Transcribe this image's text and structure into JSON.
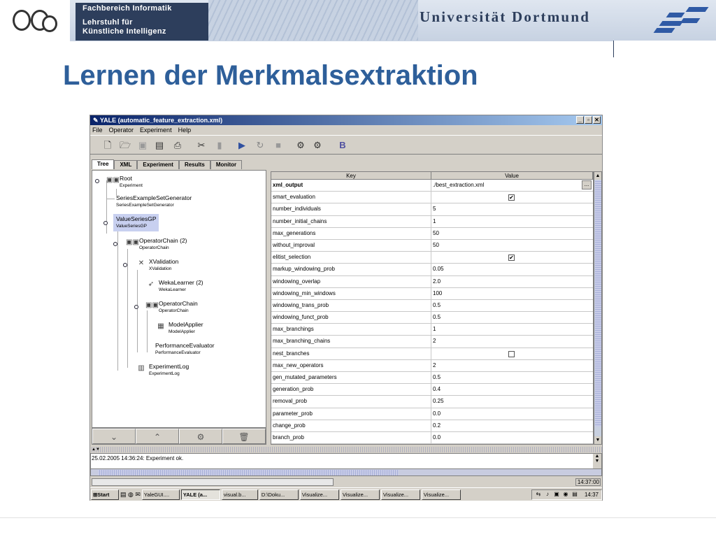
{
  "banner": {
    "dept_line1": "Fachbereich Informatik",
    "dept_line2": "Lehrstuhl für",
    "dept_line3": "Künstliche Intelligenz",
    "university": "Universität Dortmund"
  },
  "slide_title": "Lernen der Merkmalsextraktion",
  "window": {
    "title": "YALE (automatic_feature_extraction.xml)",
    "controls": [
      "_",
      "▫",
      "✕"
    ],
    "menu": [
      "File",
      "Operator",
      "Experiment",
      "Help"
    ],
    "toolbar_icons": [
      "new-file-icon",
      "open-folder-icon",
      "save-icon",
      "save-as-icon",
      "print-icon",
      "cut-icon",
      "delete-icon",
      "run-icon",
      "resume-icon",
      "stop-icon",
      "wizard-icon",
      "wizard-alt-icon",
      "b-icon"
    ],
    "tabs": [
      "Tree",
      "XML",
      "Experiment",
      "Results",
      "Monitor"
    ],
    "active_tab": "Tree"
  },
  "tree": [
    {
      "label": "Root",
      "sub": "Experiment"
    },
    {
      "label": "SeriesExampleSetGenerator",
      "sub": "SeriesExampleSetGenerator"
    },
    {
      "label": "ValueSeriesGP",
      "sub": "ValueSeriesGP"
    },
    {
      "label": "OperatorChain (2)",
      "sub": "OperatorChain"
    },
    {
      "label": "XValidation",
      "sub": "XValidation"
    },
    {
      "label": "WekaLearner (2)",
      "sub": "WekaLearner"
    },
    {
      "label": "OperatorChain",
      "sub": "OperatorChain"
    },
    {
      "label": "ModelApplier",
      "sub": "ModelApplier"
    },
    {
      "label": "PerformanceEvaluator",
      "sub": "PerformanceEvaluator"
    },
    {
      "label": "ExperimentLog",
      "sub": "ExperimentLog"
    }
  ],
  "tree_buttons": [
    "move-down-icon",
    "move-up-icon",
    "wizard-icon",
    "trash-icon"
  ],
  "table": {
    "headers": [
      "Key",
      "Value"
    ],
    "rows": [
      {
        "key": "xml_output",
        "value": "./best_extraction.xml",
        "type": "file"
      },
      {
        "key": "smart_evaluation",
        "value": "true",
        "type": "checkbox"
      },
      {
        "key": "number_individuals",
        "value": "5"
      },
      {
        "key": "number_initial_chains",
        "value": "1"
      },
      {
        "key": "max_generations",
        "value": "50"
      },
      {
        "key": "without_improval",
        "value": "50"
      },
      {
        "key": "elitist_selection",
        "value": "true",
        "type": "checkbox"
      },
      {
        "key": "markup_windowing_prob",
        "value": "0.05"
      },
      {
        "key": "windowing_overlap",
        "value": "2.0"
      },
      {
        "key": "windowing_min_windows",
        "value": "100"
      },
      {
        "key": "windowing_trans_prob",
        "value": "0.5"
      },
      {
        "key": "windowing_funct_prob",
        "value": "0.5"
      },
      {
        "key": "max_branchings",
        "value": "1"
      },
      {
        "key": "max_branching_chains",
        "value": "2"
      },
      {
        "key": "nest_branches",
        "value": "false",
        "type": "checkbox"
      },
      {
        "key": "max_new_operators",
        "value": "2"
      },
      {
        "key": "gen_mutated_parameters",
        "value": "0.5"
      },
      {
        "key": "generation_prob",
        "value": "0.4"
      },
      {
        "key": "removal_prob",
        "value": "0.25"
      },
      {
        "key": "parameter_prob",
        "value": "0.0"
      },
      {
        "key": "change_prob",
        "value": "0.2"
      },
      {
        "key": "branch_prob",
        "value": "0.0"
      }
    ],
    "file_button": "..."
  },
  "log": {
    "message": "25.02.2005 14:36:24: Experiment ok."
  },
  "status": {
    "clock": "14:37:00"
  },
  "taskbar": {
    "start": "Start",
    "items": [
      "YaleGUI....",
      "YALE (a...",
      "visual.b...",
      "D:\\Doku...",
      "Visualize...",
      "Visualize...",
      "Visualize...",
      "Visualize..."
    ],
    "active_item": "YALE (a...",
    "time": "14:37"
  }
}
